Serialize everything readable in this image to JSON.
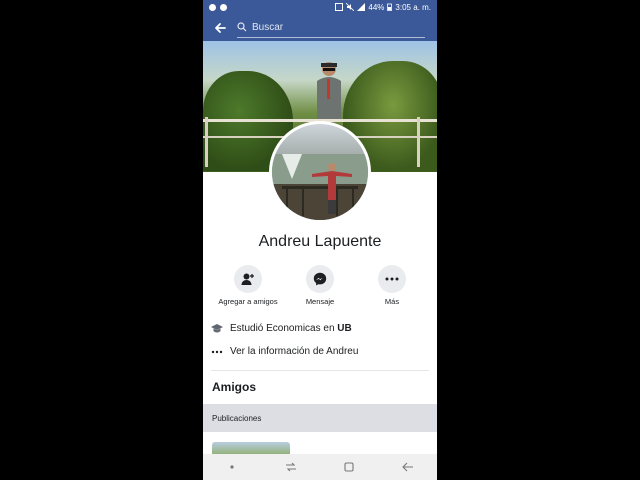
{
  "status_bar": {
    "battery": "44%",
    "time": "3:05 a. m."
  },
  "search": {
    "placeholder": "Buscar"
  },
  "profile": {
    "name": "Andreu Lapuente"
  },
  "actions": [
    {
      "label": "Agregar a amigos",
      "icon": "add-friend-icon"
    },
    {
      "label": "Mensaje",
      "icon": "messenger-icon"
    },
    {
      "label": "Más",
      "icon": "more-icon"
    }
  ],
  "info": {
    "education_prefix": "Estudió Economicas en ",
    "education_school": "UB",
    "see_info": "Ver la información de Andreu"
  },
  "sections": {
    "friends": "Amigos",
    "posts": "Publicaciones"
  },
  "colors": {
    "brand": "#3b5998"
  }
}
